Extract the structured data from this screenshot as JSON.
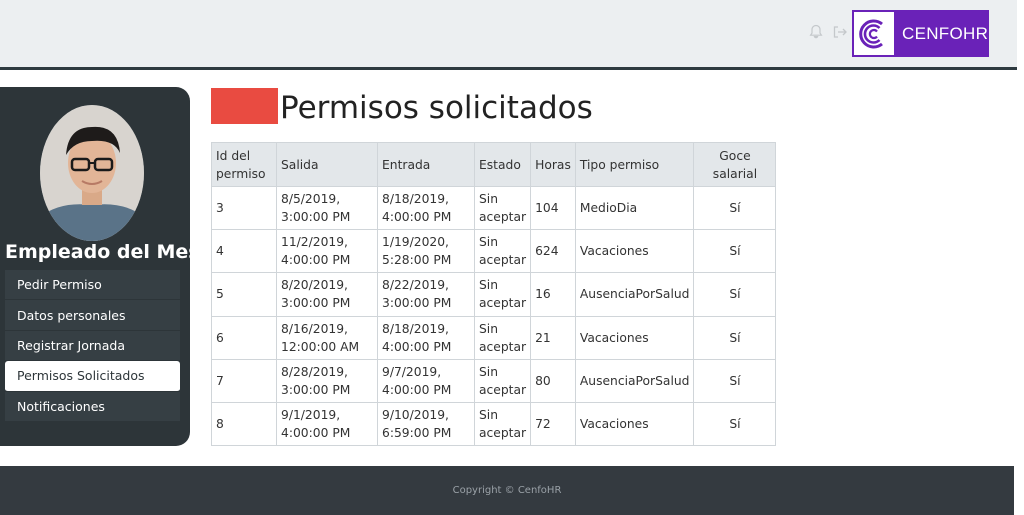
{
  "header": {
    "brand_text": "CENFOHR",
    "icons": [
      "bell-icon",
      "logout-icon"
    ]
  },
  "sidebar": {
    "employee_title": "Empleado del Mes",
    "items": [
      {
        "label": "Pedir Permiso",
        "active": false
      },
      {
        "label": "Datos personales",
        "active": false
      },
      {
        "label": "Registrar Jornada",
        "active": false
      },
      {
        "label": "Permisos Solicitados",
        "active": true
      },
      {
        "label": "Notificaciones",
        "active": false
      }
    ]
  },
  "main": {
    "title": "Permisos solicitados",
    "accent_color": "#e94b41",
    "table": {
      "headers": [
        "Id del permiso",
        "Salida",
        "Entrada",
        "Estado",
        "Horas",
        "Tipo permiso",
        "Goce salarial"
      ],
      "rows": [
        [
          "3",
          "8/5/2019, 3:00:00 PM",
          "8/18/2019, 4:00:00 PM",
          "Sin aceptar",
          "104",
          "MedioDia",
          "Sí"
        ],
        [
          "4",
          "11/2/2019, 4:00:00 PM",
          "1/19/2020, 5:28:00 PM",
          "Sin aceptar",
          "624",
          "Vacaciones",
          "Sí"
        ],
        [
          "5",
          "8/20/2019, 3:00:00 PM",
          "8/22/2019, 3:00:00 PM",
          "Sin aceptar",
          "16",
          "AusenciaPorSalud",
          "Sí"
        ],
        [
          "6",
          "8/16/2019, 12:00:00 AM",
          "8/18/2019, 4:00:00 PM",
          "Sin aceptar",
          "21",
          "Vacaciones",
          "Sí"
        ],
        [
          "7",
          "8/28/2019, 3:00:00 PM",
          "9/7/2019, 4:00:00 PM",
          "Sin aceptar",
          "80",
          "AusenciaPorSalud",
          "Sí"
        ],
        [
          "8",
          "9/1/2019, 4:00:00 PM",
          "9/10/2019, 6:59:00 PM",
          "Sin aceptar",
          "72",
          "Vacaciones",
          "Sí"
        ]
      ]
    }
  },
  "footer": {
    "copyright": "Copyright © CenfoHR"
  },
  "colors": {
    "brand": "#6a22b8",
    "sidebar_bg": "#2d3539",
    "footer_bg": "#343a40",
    "accent": "#e94b41"
  }
}
